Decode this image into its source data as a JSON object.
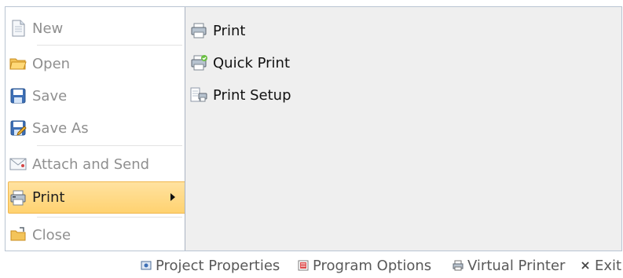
{
  "menu": {
    "items": [
      {
        "label": "New"
      },
      {
        "label": "Open"
      },
      {
        "label": "Save"
      },
      {
        "label": "Save As"
      },
      {
        "label": "Attach and Send"
      },
      {
        "label": "Print",
        "selected": true
      },
      {
        "label": "Close"
      }
    ]
  },
  "submenu": {
    "items": [
      {
        "label": "Print"
      },
      {
        "label": "Quick Print"
      },
      {
        "label": "Print Setup"
      }
    ]
  },
  "footer": {
    "buttons": [
      {
        "label": "Project Properties",
        "icon": "project-properties-icon"
      },
      {
        "label": "Program Options",
        "icon": "program-options-icon"
      },
      {
        "label": "Virtual Printer",
        "icon": "virtual-printer-icon"
      },
      {
        "label": "Exit",
        "icon": "exit-icon"
      }
    ]
  },
  "colors": {
    "selected_bg_top": "#ffe2a0",
    "selected_bg_bottom": "#ffd270",
    "selected_border": "#f0b64d",
    "panel_bg": "#efefef",
    "menu_text_disabled": "#8f8f8f",
    "text_dark": "#111111"
  }
}
